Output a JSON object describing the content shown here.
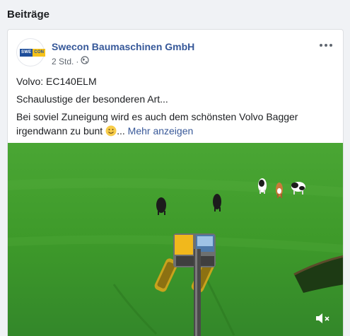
{
  "section": {
    "title": "Beiträge"
  },
  "post": {
    "page_name": "Swecon Baumaschinen GmbH",
    "timestamp": "2 Std.",
    "separator": "·",
    "audience_icon": "globe-icon",
    "avatar_logo_text": [
      "SWE",
      "CON"
    ],
    "text": {
      "line1": "Volvo: EC140ELM",
      "line2": "Schaulustige der besonderen Art...",
      "line3": "Bei soviel Zuneigung wird es auch dem schönsten Volvo Bagger irgendwann zu bunt",
      "emoji": "smiley-emoji",
      "ellipsis": "...",
      "see_more": "Mehr anzeigen"
    },
    "media": {
      "type": "video",
      "content": "aerial view of excavator in green meadow with cows",
      "volume_icon": "speaker-muted-icon"
    },
    "menu_icon": "more-options-icon"
  },
  "colors": {
    "link": "#365899",
    "grass": "#3f9a2c",
    "logo_blue": "#1f4e9a",
    "logo_yellow": "#f6c21a"
  }
}
